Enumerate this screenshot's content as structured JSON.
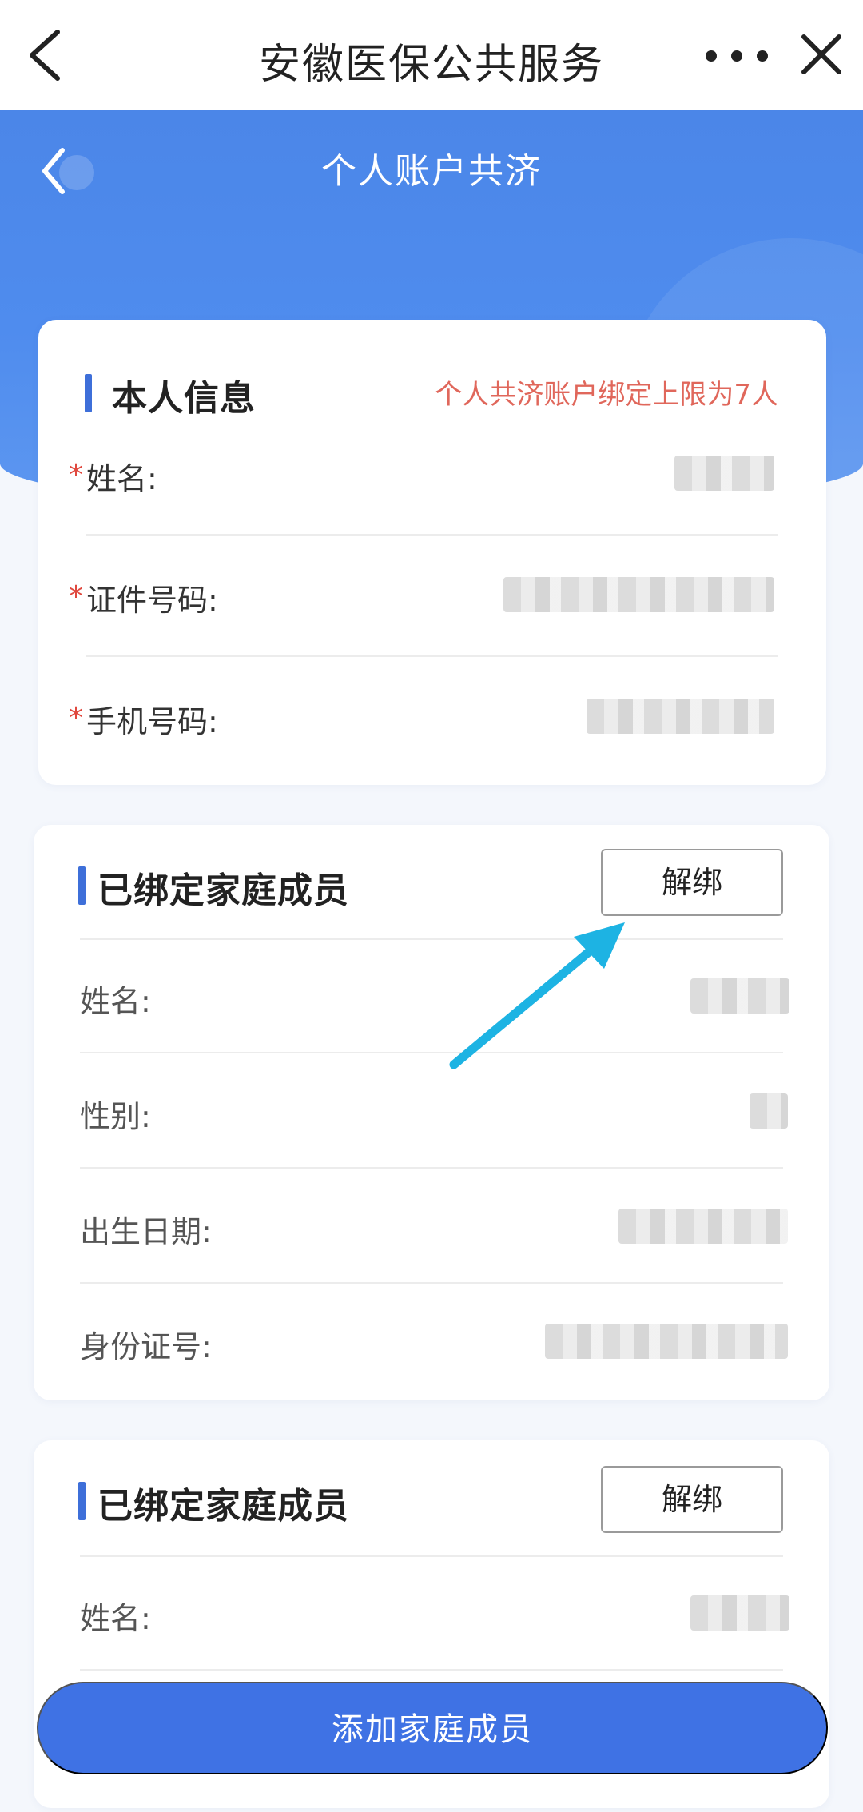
{
  "appbar": {
    "title": "安徽医保公共服务",
    "back_icon": "chevron-left-icon",
    "more_icon": "more-dots-icon",
    "close_icon": "close-icon"
  },
  "header": {
    "title": "个人账户共济",
    "back_icon": "chevron-left-icon"
  },
  "self_info": {
    "title": "本人信息",
    "note": "个人共济账户绑定上限为7人",
    "required_mark": "*",
    "fields": [
      {
        "label": "姓名:"
      },
      {
        "label": "证件号码:"
      },
      {
        "label": "手机号码:"
      }
    ]
  },
  "members": [
    {
      "title": "已绑定家庭成员",
      "unbind_label": "解绑",
      "fields": [
        {
          "label": "姓名:"
        },
        {
          "label": "性别:"
        },
        {
          "label": "出生日期:"
        },
        {
          "label": "身份证号:"
        }
      ]
    },
    {
      "title": "已绑定家庭成员",
      "unbind_label": "解绑",
      "fields": [
        {
          "label": "姓名:"
        }
      ]
    }
  ],
  "footer": {
    "add_label": "添加家庭成员"
  },
  "colors": {
    "brand_blue": "#3f72e4",
    "header_blue": "#4b86e8",
    "note_red": "#e0675b",
    "required_red": "#e0483e",
    "arrow_cyan": "#1db3e3"
  }
}
